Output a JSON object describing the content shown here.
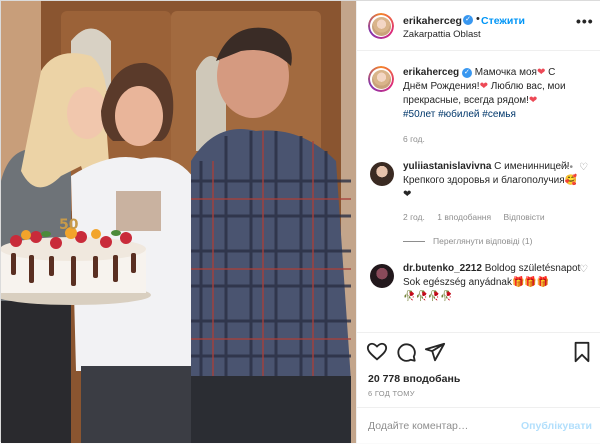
{
  "post": {
    "author": "erikaherceg",
    "follow_label": "Стежити",
    "separator": "•",
    "location": "Zakarpattia Oblast",
    "more_label": "•••",
    "verified_mark": "✓"
  },
  "caption": {
    "author": "erikaherceg",
    "text_part1": "Мамочка моя",
    "text_part2": " С Днём Рождения!",
    "text_part3": " Люблю вас, мои прекрасные, всегда рядом!",
    "heart_emoji": "❤",
    "hashtags": [
      "#50лет",
      "#юбилей",
      "#семья"
    ],
    "time": "6 год."
  },
  "comments": [
    {
      "author": "yuliiastanislavivna",
      "text": " С именинницей! Крепкого здоровья и благополучия",
      "emoji": "🥰❤",
      "time": "2 год.",
      "likes": "1 вподобання",
      "reply_label": "Відповісти",
      "view_replies": "Переглянути відповіді (1)",
      "dots": "•••"
    },
    {
      "author": "dr.butenko_2212",
      "text": " Boldog születésnapot Sok egészség anyádnak",
      "emoji": "🎁🎁🎁",
      "emoji_line2": "🥀🥀🥀🥀"
    }
  ],
  "footer": {
    "likes": "20 778 вподобань",
    "time": "6 ГОД ТОМУ",
    "comment_placeholder": "Додайте коментар…",
    "publish_label": "Опублікувати"
  },
  "photo": {
    "cake_topper": "50"
  },
  "colors": {
    "accent": "#0095f6",
    "link": "#00376b",
    "heart": "#ed4956",
    "muted": "#8e8e8e"
  }
}
